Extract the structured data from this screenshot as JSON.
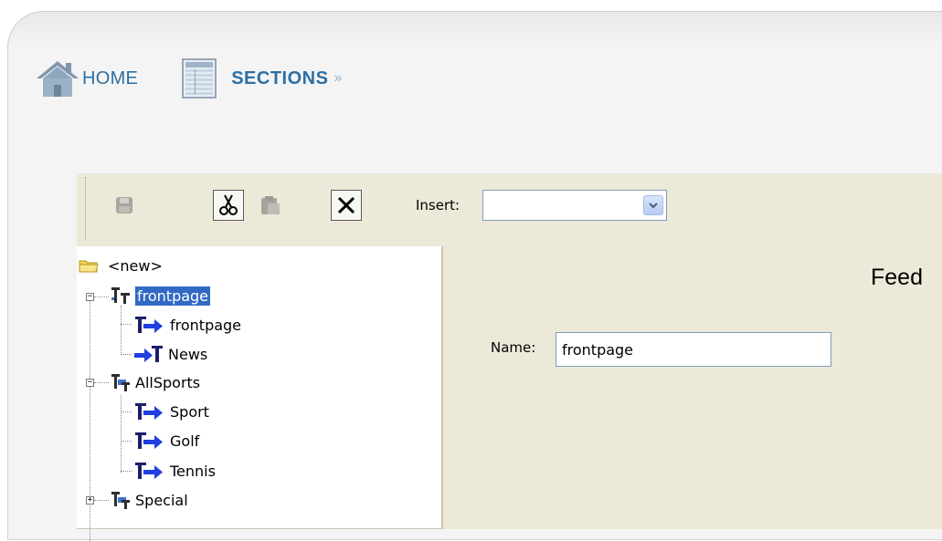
{
  "breadcrumb": {
    "home_label": "HOME",
    "sections_label": "SECTIONS",
    "separator": "»"
  },
  "toolbar": {
    "buttons": [
      {
        "icon": "save-icon",
        "enabled": false
      },
      {
        "icon": "cut-icon",
        "enabled": true
      },
      {
        "icon": "paste-icon",
        "enabled": false
      },
      {
        "icon": "delete-icon",
        "enabled": true
      }
    ],
    "insert_label": "Insert:",
    "insert_value": ""
  },
  "tree": {
    "items": [
      {
        "label": "<new>",
        "icon": "folder-icon"
      },
      {
        "label": "frontpage",
        "icon": "section-icon",
        "selected": true,
        "expanded": true
      },
      {
        "label": "frontpage",
        "icon": "feed-link-icon"
      },
      {
        "label": "News",
        "icon": "feed-link-reverse-icon"
      },
      {
        "label": "AllSports",
        "icon": "section-group-icon",
        "expanded": true
      },
      {
        "label": "Sport",
        "icon": "feed-link-icon"
      },
      {
        "label": "Golf",
        "icon": "feed-link-icon"
      },
      {
        "label": "Tennis",
        "icon": "feed-link-icon"
      },
      {
        "label": "Special",
        "icon": "section-group-icon",
        "expanded": false
      }
    ]
  },
  "content": {
    "title": "Feed",
    "name_label": "Name:",
    "name_value": "frontpage"
  },
  "colors": {
    "breadcrumb_text": "#2d6fa3",
    "toolbar_bg": "#ece9d8",
    "selection_bg": "#316ac5",
    "input_border": "#7f9db9"
  }
}
